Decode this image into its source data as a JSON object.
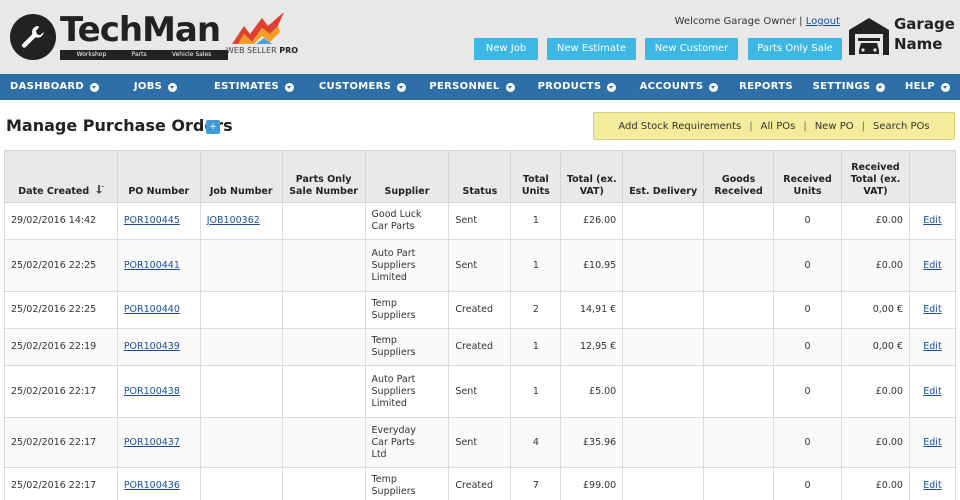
{
  "header": {
    "logo_text": "TechMan",
    "logo_tagline": [
      "Workshop",
      "Parts",
      "Vehicle Sales"
    ],
    "logo_sub_prefix": "WEB SELLER",
    "logo_sub_suffix": "PRO",
    "welcome_prefix": "Welcome Garage Owner |",
    "logout_label": "Logout",
    "buttons": [
      "New Job",
      "New Estimate",
      "New Customer",
      "Parts Only Sale"
    ],
    "garage_line1": "Garage",
    "garage_line2": "Name"
  },
  "nav": [
    {
      "label": "DASHBOARD",
      "dropdown": true
    },
    {
      "label": "JOBS",
      "dropdown": true
    },
    {
      "label": "ESTIMATES",
      "dropdown": true
    },
    {
      "label": "CUSTOMERS",
      "dropdown": true
    },
    {
      "label": "PERSONNEL",
      "dropdown": true
    },
    {
      "label": "PRODUCTS",
      "dropdown": true
    },
    {
      "label": "ACCOUNTS",
      "dropdown": true
    },
    {
      "label": "REPORTS",
      "dropdown": false
    },
    {
      "label": "SETTINGS",
      "dropdown": true
    },
    {
      "label": "HELP",
      "dropdown": true
    }
  ],
  "page": {
    "title": "Manage Purchase Orders",
    "title_icon": "plus-icon"
  },
  "actions": [
    "Add Stock Requirements",
    "All POs",
    "New PO",
    "Search POs"
  ],
  "table": {
    "columns": [
      "Date Created",
      "PO Number",
      "Job Number",
      "Parts Only Sale Number",
      "Supplier",
      "Status",
      "Total Units",
      "Total (ex. VAT)",
      "Est. Delivery",
      "Goods Received",
      "Received Units",
      "Received Total (ex. VAT)",
      ""
    ],
    "sort_icon": "sort-desc-icon",
    "rows": [
      {
        "date": "29/02/2016 14:42",
        "po": "POR100445",
        "job": "JOB100362",
        "pos": "",
        "supplier": [
          "Good Luck",
          "Car Parts"
        ],
        "status": "Sent",
        "units": "1",
        "total": "£26.00",
        "delivery": "",
        "received": "",
        "recv_units": "0",
        "recv_total": "£0.00",
        "edit": "Edit"
      },
      {
        "date": "25/02/2016 22:25",
        "po": "POR100441",
        "job": "",
        "pos": "",
        "supplier": [
          "Auto Part",
          "Suppliers",
          "Limited"
        ],
        "status": "Sent",
        "units": "1",
        "total": "£10.95",
        "delivery": "",
        "received": "",
        "recv_units": "0",
        "recv_total": "£0.00",
        "edit": "Edit"
      },
      {
        "date": "25/02/2016 22:25",
        "po": "POR100440",
        "job": "",
        "pos": "",
        "supplier": [
          "Temp",
          "Suppliers"
        ],
        "status": "Created",
        "units": "2",
        "total": "14,91 €",
        "delivery": "",
        "received": "",
        "recv_units": "0",
        "recv_total": "0,00 €",
        "edit": "Edit"
      },
      {
        "date": "25/02/2016 22:19",
        "po": "POR100439",
        "job": "",
        "pos": "",
        "supplier": [
          "Temp",
          "Suppliers"
        ],
        "status": "Created",
        "units": "1",
        "total": "12,95 €",
        "delivery": "",
        "received": "",
        "recv_units": "0",
        "recv_total": "0,00 €",
        "edit": "Edit"
      },
      {
        "date": "25/02/2016 22:17",
        "po": "POR100438",
        "job": "",
        "pos": "",
        "supplier": [
          "Auto Part",
          "Suppliers",
          "Limited"
        ],
        "status": "Sent",
        "units": "1",
        "total": "£5.00",
        "delivery": "",
        "received": "",
        "recv_units": "0",
        "recv_total": "£0.00",
        "edit": "Edit"
      },
      {
        "date": "25/02/2016 22:17",
        "po": "POR100437",
        "job": "",
        "pos": "",
        "supplier": [
          "Everyday",
          "Car Parts",
          "Ltd"
        ],
        "status": "Sent",
        "units": "4",
        "total": "£35.96",
        "delivery": "",
        "received": "",
        "recv_units": "0",
        "recv_total": "£0.00",
        "edit": "Edit"
      },
      {
        "date": "25/02/2016 22:17",
        "po": "POR100436",
        "job": "",
        "pos": "",
        "supplier": [
          "Temp",
          "Suppliers"
        ],
        "status": "Created",
        "units": "7",
        "total": "£99.00",
        "delivery": "",
        "received": "",
        "recv_units": "0",
        "recv_total": "£0.00",
        "edit": "Edit"
      }
    ]
  },
  "colors": {
    "nav_bg": "#2f6fa7",
    "button_bg": "#3db7e4",
    "actions_bg": "#f3ec9a",
    "link": "#1a4fa0"
  }
}
